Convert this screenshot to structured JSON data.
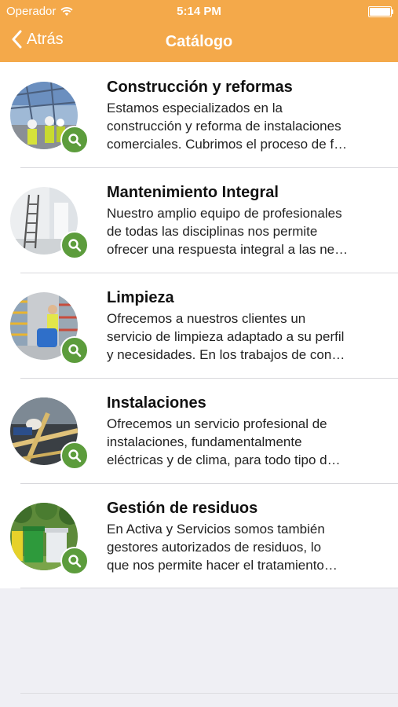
{
  "status_bar": {
    "carrier": "Operador",
    "time": "5:14 PM",
    "signal_icon": "wifi-icon",
    "battery_icon": "battery-icon"
  },
  "nav": {
    "back_label": "Atrás",
    "back_icon": "chevron-left-icon",
    "title": "Catálogo"
  },
  "colors": {
    "header": "#f4a94a",
    "zoom_badge": "#5c9c3c"
  },
  "items": [
    {
      "title": "Construcción y reformas",
      "lines": [
        "Estamos especializados en la",
        "construcción y reforma de instalaciones",
        "comerciales. Cubrimos el proceso de f…"
      ]
    },
    {
      "title": "Mantenimiento Integral",
      "lines": [
        "Nuestro amplio equipo de profesionales",
        "de todas las disciplinas nos permite",
        "ofrecer una respuesta integral a las ne…"
      ]
    },
    {
      "title": "Limpieza",
      "lines": [
        "Ofrecemos a nuestros clientes un",
        "servicio de limpieza adaptado a su perfil",
        "y necesidades. En los trabajos de con…"
      ]
    },
    {
      "title": "Instalaciones",
      "lines": [
        "Ofrecemos un servicio profesional de",
        "instalaciones, fundamentalmente",
        "eléctricas y de clima, para todo tipo d…"
      ]
    },
    {
      "title": "Gestión de residuos",
      "lines": [
        "En Activa y Servicios somos también",
        "gestores autorizados de residuos, lo",
        "que nos permite hacer el tratamiento…"
      ]
    }
  ]
}
